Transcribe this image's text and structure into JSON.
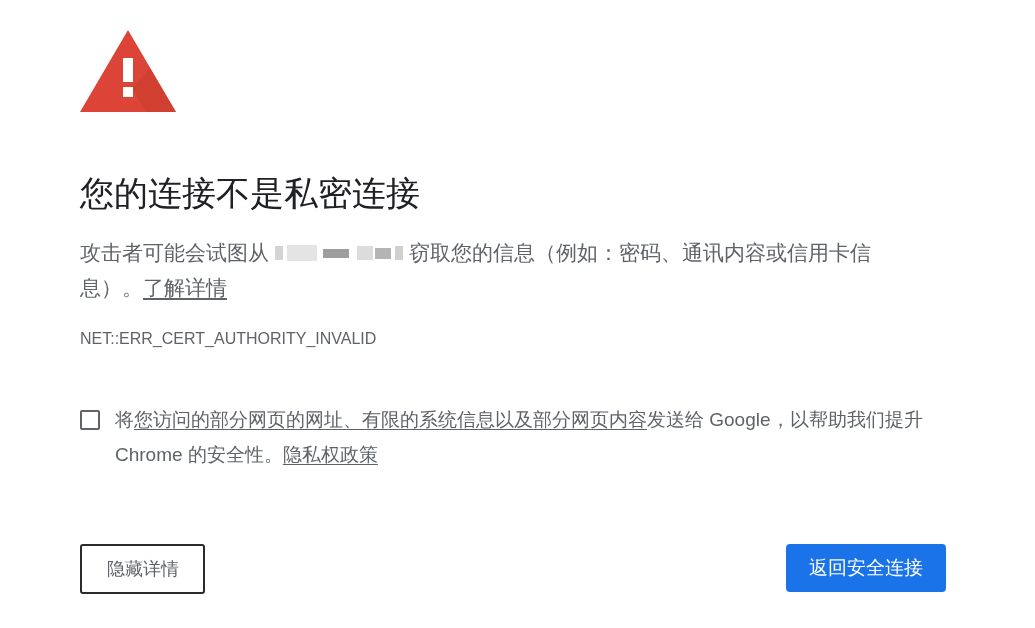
{
  "heading": "您的连接不是私密连接",
  "explanation": [
    {
      "kind": "text",
      "text": "攻击者可能会试图从 "
    },
    {
      "kind": "redacted"
    },
    {
      "kind": "text",
      "text": " 窃取您的信息（例如：密码、通讯内容或信用卡信息）。"
    },
    {
      "kind": "link",
      "text": "了解详情"
    }
  ],
  "error_code": "NET::ERR_CERT_AUTHORITY_INVALID",
  "report_opt_in": {
    "checked": false,
    "parts": [
      {
        "kind": "text",
        "text": "将"
      },
      {
        "kind": "link",
        "text": "您访问的部分网页的网址、有限的系统信息以及部分网页内容"
      },
      {
        "kind": "text",
        "text": "发送给 Google，以帮助我们提升 Chrome 的安全性。"
      },
      {
        "kind": "link",
        "text": "隐私权政策"
      }
    ]
  },
  "buttons": [
    {
      "kind": "outline",
      "label": "隐藏详情"
    },
    {
      "kind": "primary",
      "label": "返回安全连接"
    }
  ]
}
